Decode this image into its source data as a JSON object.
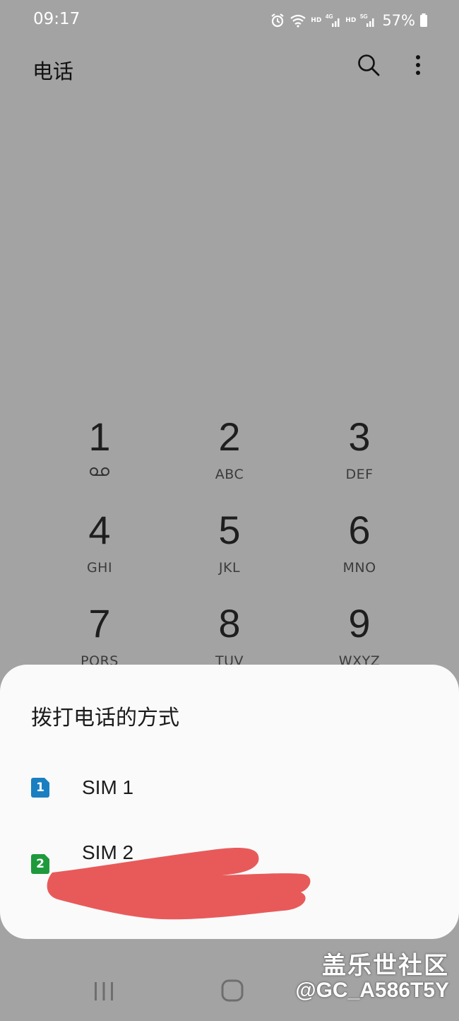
{
  "status_bar": {
    "time": "09:17",
    "icons": [
      "alarm-icon",
      "wifi-icon",
      "signal-4g-icon",
      "signal-5g-icon",
      "battery-icon"
    ],
    "hd1": "HD",
    "hd2": "HD",
    "battery": "57%"
  },
  "app": {
    "title": "电话",
    "search_icon": "search-icon",
    "more_icon": "more-vert-icon"
  },
  "keypad": {
    "k1": {
      "digit": "1",
      "sub_icon": "voicemail-icon"
    },
    "k2": {
      "digit": "2",
      "letters": "ABC"
    },
    "k3": {
      "digit": "3",
      "letters": "DEF"
    },
    "k4": {
      "digit": "4",
      "letters": "GHI"
    },
    "k5": {
      "digit": "5",
      "letters": "JKL"
    },
    "k6": {
      "digit": "6",
      "letters": "MNO"
    },
    "k7": {
      "digit": "7",
      "letters": "PQRS"
    },
    "k8": {
      "digit": "8",
      "letters": "TUV"
    },
    "k9": {
      "digit": "9",
      "letters": "WXYZ"
    }
  },
  "dialog": {
    "title": "拨打电话的方式",
    "options": [
      {
        "badge": "1",
        "label": "SIM 1",
        "color": "#1a7fc1"
      },
      {
        "badge": "2",
        "label": "SIM 2",
        "color": "#1e9a3c"
      }
    ],
    "redaction_color": "#e85a5a"
  },
  "nav_bar": {
    "icons": [
      "recents-icon",
      "home-icon"
    ]
  },
  "watermark": {
    "line1": "盖乐世社区",
    "line2": "@GC_A586T5Y"
  }
}
